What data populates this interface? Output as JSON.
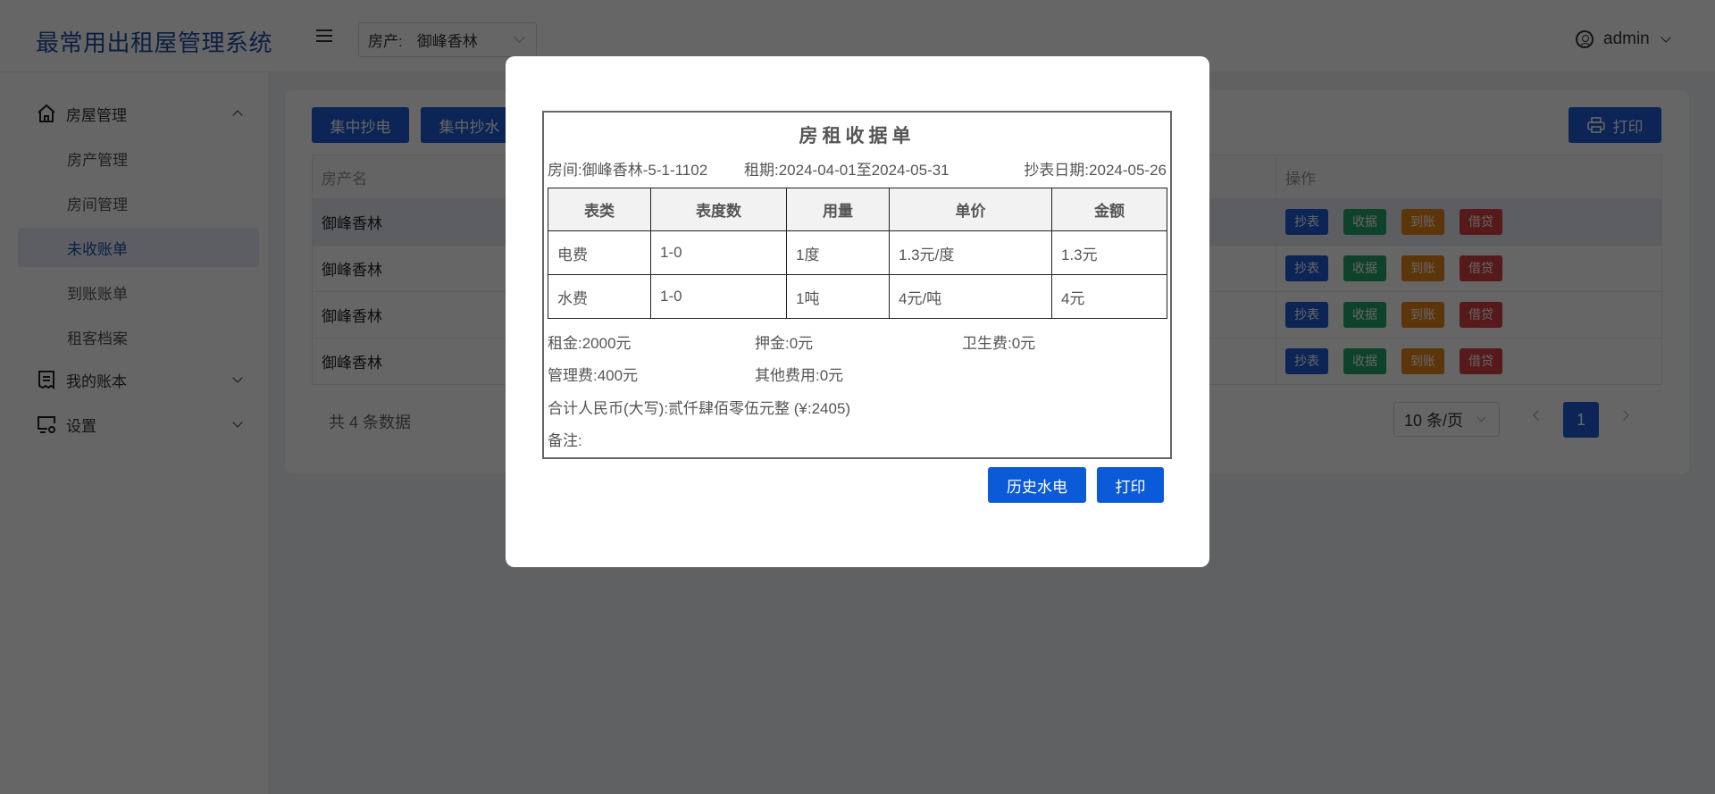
{
  "header": {
    "app_title": "最常用出租屋管理系统",
    "property_label": "房产:",
    "property_value": "御峰香林",
    "username": "admin"
  },
  "sidebar": {
    "groups": [
      {
        "label": "房屋管理",
        "icon": "home-icon",
        "expanded": true,
        "items": [
          {
            "label": "房产管理",
            "active": false
          },
          {
            "label": "房间管理",
            "active": false
          },
          {
            "label": "未收账单",
            "active": true
          },
          {
            "label": "到账账单",
            "active": false
          },
          {
            "label": "租客档案",
            "active": false
          }
        ]
      },
      {
        "label": "我的账本",
        "icon": "ledger-icon",
        "expanded": false
      },
      {
        "label": "设置",
        "icon": "settings-monitor-icon",
        "expanded": false
      }
    ]
  },
  "toolbar": {
    "batch_electric_label": "集中抄电",
    "batch_water_label": "集中抄水",
    "print_label": "打印"
  },
  "table": {
    "columns": {
      "property_name": "房产名",
      "operations": "操作"
    },
    "rows": [
      {
        "property_name": "御峰香林"
      },
      {
        "property_name": "御峰香林"
      },
      {
        "property_name": "御峰香林"
      },
      {
        "property_name": "御峰香林"
      }
    ],
    "row_actions": [
      "抄表",
      "收据",
      "到账",
      "借贷"
    ],
    "action_colors": [
      "#1f5ad8",
      "#27a56a",
      "#e6861a",
      "#d64242"
    ]
  },
  "pagination": {
    "total_text": "共 4 条数据",
    "page_size": "10 条/页",
    "current_page": "1"
  },
  "modal": {
    "receipt": {
      "title": "房租收据单",
      "room": "房间:御峰香林-5-1-1102",
      "period": "租期:2024-04-01至2024-05-31",
      "reading_date": "抄表日期:2024-05-26",
      "columns": [
        "表类",
        "表度数",
        "用量",
        "单价",
        "金额"
      ],
      "rows": [
        [
          "电费",
          "1-0",
          "1度",
          "1.3元/度",
          "1.3元"
        ],
        [
          "水费",
          "1-0",
          "1吨",
          "4元/吨",
          "4元"
        ]
      ],
      "rent": "租金:2000元",
      "deposit": "押金:0元",
      "sanitation": "卫生费:0元",
      "management": "管理费:400元",
      "other": "其他费用:0元",
      "total": "合计人民币(大写):贰仟肆佰零伍元整 (¥:2405)",
      "remarks": "备注:"
    },
    "history_button": "历史水电",
    "print_button": "打印"
  },
  "colors": {
    "brand": "#1e4fa8",
    "primary": "#1f5ad8",
    "success": "#27a56a",
    "warning": "#e6861a",
    "danger": "#d64242"
  }
}
